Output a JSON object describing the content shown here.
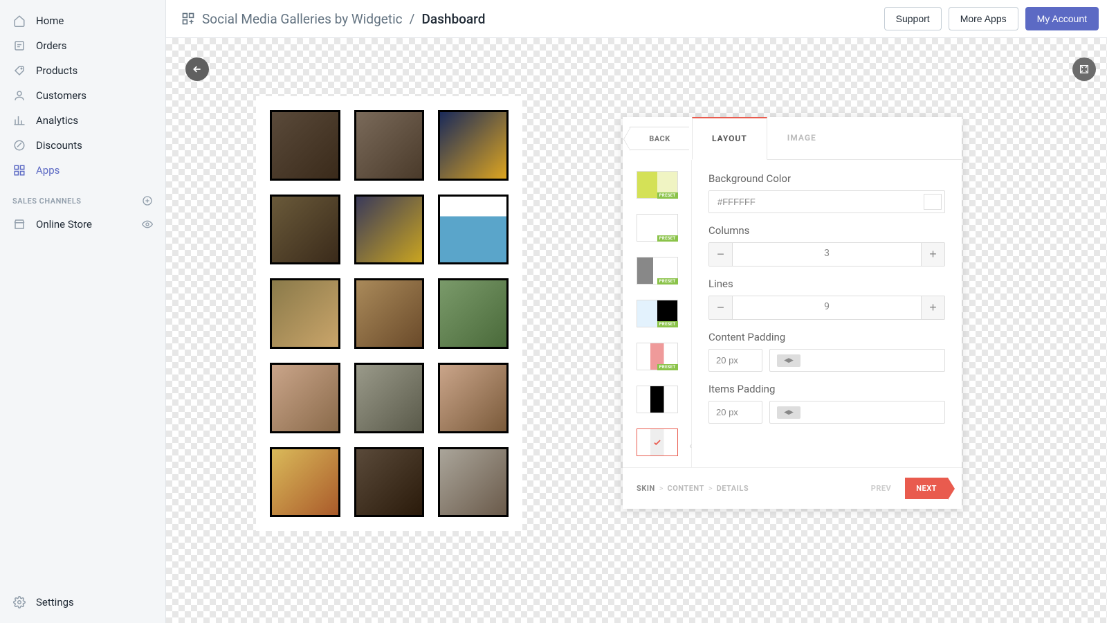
{
  "sidebar": {
    "items": [
      {
        "label": "Home",
        "icon": "home"
      },
      {
        "label": "Orders",
        "icon": "orders"
      },
      {
        "label": "Products",
        "icon": "products"
      },
      {
        "label": "Customers",
        "icon": "customers"
      },
      {
        "label": "Analytics",
        "icon": "analytics"
      },
      {
        "label": "Discounts",
        "icon": "discounts"
      },
      {
        "label": "Apps",
        "icon": "apps",
        "active": true
      }
    ],
    "section_label": "SALES CHANNELS",
    "channels": [
      {
        "label": "Online Store"
      }
    ],
    "settings_label": "Settings"
  },
  "topbar": {
    "app_name": "Social Media Galleries by Widgetic",
    "sep": "/",
    "page": "Dashboard",
    "support": "Support",
    "more_apps": "More Apps",
    "my_account": "My Account"
  },
  "panel": {
    "back": "BACK",
    "tabs": {
      "layout": "LAYOUT",
      "image": "IMAGE"
    },
    "preset_tag": "PRESET",
    "fields": {
      "bg_label": "Background Color",
      "bg_value": "#FFFFFF",
      "cols_label": "Columns",
      "cols_value": "3",
      "lines_label": "Lines",
      "lines_value": "9",
      "cpad_label": "Content Padding",
      "cpad_value": "20 px",
      "ipad_label": "Items Padding",
      "ipad_value": "20 px"
    },
    "footer": {
      "skin": "SKIN",
      "content": "CONTENT",
      "details": "DETAILS",
      "prev": "PREV",
      "next": "NEXT"
    }
  }
}
